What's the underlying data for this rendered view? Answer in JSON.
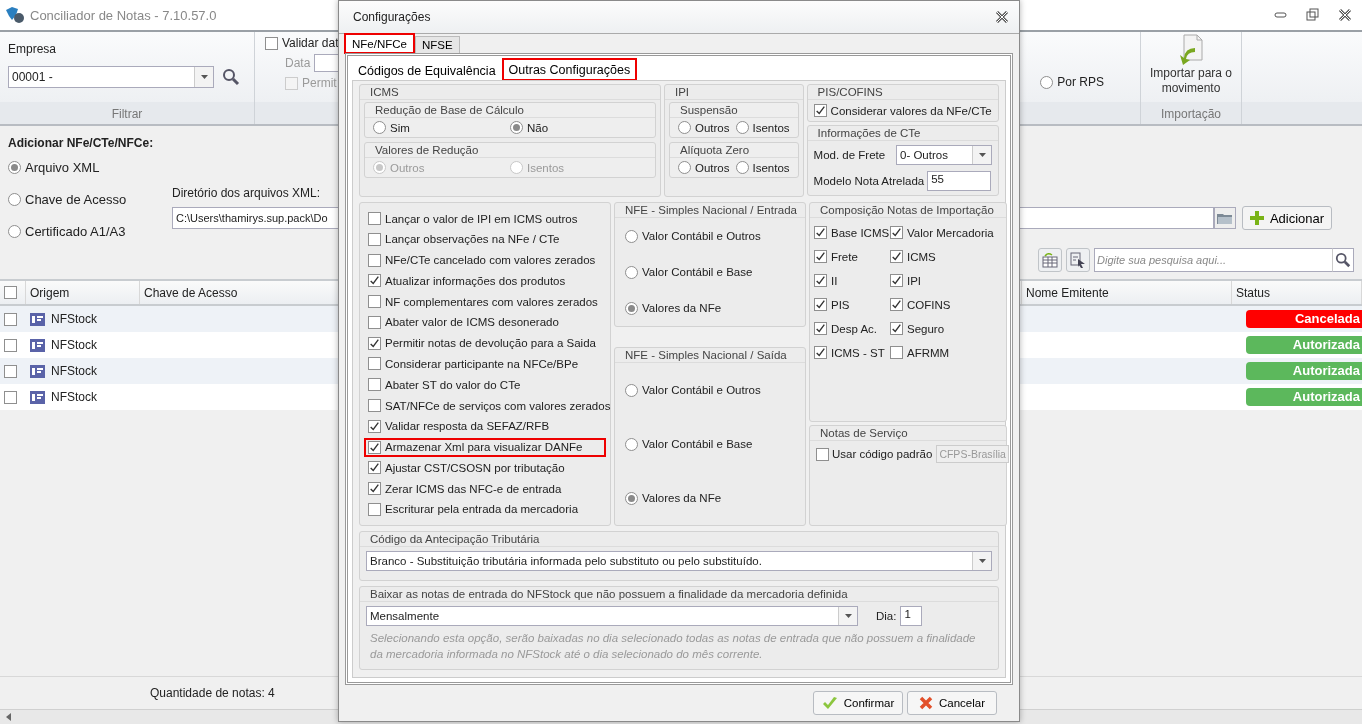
{
  "app": {
    "title": "Conciliador de Notas - 7.10.57.0",
    "ribbon": {
      "empresa_label": "Empresa",
      "empresa_value": "00001 -",
      "filter_group": "Filtrar",
      "validar": {
        "label": "Validar dat",
        "checked": false
      },
      "data_label": "Data",
      "permit": {
        "label": "Permit",
        "checked": false,
        "disabled": true
      },
      "por_rps": {
        "label": "Por RPS",
        "selected": false
      },
      "import_button": "Importar para o movimento",
      "import_group": "Importação"
    },
    "add_section": {
      "title": "Adicionar NFe/CTe/NFCe:",
      "sources": [
        {
          "label": "Arquivo XML",
          "selected": true
        },
        {
          "label": "Chave de Acesso",
          "selected": false
        },
        {
          "label": "Certificado A1/A3",
          "selected": false
        }
      ],
      "dir_label": "Diretório dos arquivos XML:",
      "dir_value": "C:\\Users\\thamirys.sup.pack\\Do",
      "add_button": "Adicionar",
      "search_placeholder": "Digite sua pesquisa aqui..."
    },
    "table": {
      "select_all_checked": false,
      "columns": [
        "Origem",
        "Chave de Acesso",
        "Nome Emitente",
        "Status"
      ],
      "rows": [
        {
          "checked": false,
          "origin": "NFStock",
          "status": "Cancelada",
          "color": "#ff0000"
        },
        {
          "checked": false,
          "origin": "NFStock",
          "status": "Autorizada",
          "color": "#5cb85c"
        },
        {
          "checked": false,
          "origin": "NFStock",
          "status": "Autorizada",
          "color": "#5cb85c"
        },
        {
          "checked": false,
          "origin": "NFStock",
          "status": "Autorizada",
          "color": "#5cb85c"
        }
      ]
    },
    "footer": "Quantidade de notas: 4"
  },
  "dialog": {
    "title": "Configurações",
    "tabs": [
      {
        "label": "NFe/NFCe",
        "selected": true,
        "highlighted": true
      },
      {
        "label": "NFSE",
        "selected": false,
        "highlighted": false
      }
    ],
    "subtabs": [
      {
        "label": "Códigos de Equivalência",
        "selected": false,
        "highlighted": false
      },
      {
        "label": "Outras Configurações",
        "selected": true,
        "highlighted": true
      }
    ],
    "icms": {
      "title": "ICMS",
      "groups": [
        {
          "title": "Redução de Base de Cálculo",
          "disabled": false,
          "options": [
            {
              "label": "Sim",
              "selected": false
            },
            {
              "label": "Não",
              "selected": true
            }
          ]
        },
        {
          "title": "Valores de Redução",
          "disabled": true,
          "options": [
            {
              "label": "Outros",
              "selected": true
            },
            {
              "label": "Isentos",
              "selected": false
            }
          ]
        }
      ]
    },
    "ipi": {
      "title": "IPI",
      "groups": [
        {
          "title": "Suspensão",
          "disabled": false,
          "options": [
            {
              "label": "Outros",
              "selected": false
            },
            {
              "label": "Isentos",
              "selected": false
            }
          ]
        },
        {
          "title": "Alíquota Zero",
          "disabled": false,
          "options": [
            {
              "label": "Outros",
              "selected": false
            },
            {
              "label": "Isentos",
              "selected": false
            }
          ]
        }
      ]
    },
    "pis_cofins": {
      "title": "PIS/COFINS",
      "label": "Considerar valores da NFe/CTe",
      "checked": true
    },
    "cte": {
      "title": "Informações de CTe",
      "frete_label": "Mod. de Frete",
      "frete_value": "0- Outros",
      "modelo_label": "Modelo Nota Atrelada",
      "modelo_value": "55"
    },
    "options": [
      {
        "label": "Lançar o valor de IPI em ICMS outros",
        "checked": false,
        "highlighted": false
      },
      {
        "label": "Lançar observações na NFe / CTe",
        "checked": false,
        "highlighted": false
      },
      {
        "label": "NFe/CTe cancelado com valores zerados",
        "checked": false,
        "highlighted": false
      },
      {
        "label": "Atualizar informações dos produtos",
        "checked": true,
        "highlighted": false
      },
      {
        "label": "NF complementares com valores zerados",
        "checked": false,
        "highlighted": false
      },
      {
        "label": "Abater valor de ICMS desonerado",
        "checked": false,
        "highlighted": false
      },
      {
        "label": "Permitir notas de devolução para a Saida",
        "checked": true,
        "highlighted": false
      },
      {
        "label": "Considerar participante na NFCe/BPe",
        "checked": false,
        "highlighted": false
      },
      {
        "label": "Abater ST do valor do CTe",
        "checked": false,
        "highlighted": false
      },
      {
        "label": "SAT/NFCe de serviços com valores zerados",
        "checked": false,
        "highlighted": false
      },
      {
        "label": "Validar resposta da SEFAZ/RFB",
        "checked": true,
        "highlighted": false
      },
      {
        "label": "Armazenar Xml para visualizar DANFe",
        "checked": true,
        "highlighted": true
      },
      {
        "label": "Ajustar CST/CSOSN por tributação",
        "checked": true,
        "highlighted": false
      },
      {
        "label": "Zerar ICMS das NFC-e de entrada",
        "checked": true,
        "highlighted": false
      },
      {
        "label": "Escriturar pela entrada da mercadoria",
        "checked": false,
        "highlighted": false
      }
    ],
    "simples": [
      {
        "title": "NFE - Simples Nacional / Entrada",
        "options": [
          {
            "label": "Valor Contábil e Outros",
            "selected": false
          },
          {
            "label": "Valor Contábil e Base",
            "selected": false
          },
          {
            "label": "Valores da NFe",
            "selected": true
          }
        ]
      },
      {
        "title": "NFE - Simples Nacional / Saída",
        "options": [
          {
            "label": "Valor Contábil e Outros",
            "selected": false
          },
          {
            "label": "Valor Contábil e Base",
            "selected": false
          },
          {
            "label": "Valores da NFe",
            "selected": true
          }
        ]
      }
    ],
    "composicao": {
      "title": "Composição Notas de Importação",
      "items": [
        {
          "label": "Base ICMS",
          "checked": true
        },
        {
          "label": "Valor Mercadoria",
          "checked": true
        },
        {
          "label": "Frete",
          "checked": true
        },
        {
          "label": "ICMS",
          "checked": true
        },
        {
          "label": "II",
          "checked": true
        },
        {
          "label": "IPI",
          "checked": true
        },
        {
          "label": "PIS",
          "checked": true
        },
        {
          "label": "COFINS",
          "checked": true
        },
        {
          "label": "Desp Ac.",
          "checked": true
        },
        {
          "label": "Seguro",
          "checked": true
        },
        {
          "label": "ICMS - ST",
          "checked": true
        },
        {
          "label": "AFRMM",
          "checked": false
        }
      ]
    },
    "servico": {
      "title": "Notas de Serviço",
      "label": "Usar código padrão",
      "checked": false,
      "button": "CFPS-Brasília"
    },
    "antecipacao": {
      "title": "Código da Antecipação Tributária",
      "value": "Branco - Substituição tributária informada pelo substituto ou pelo substituído."
    },
    "baixar": {
      "title": "Baixar as notas de entrada do NFStock que não possuem a finalidade da mercadoria definida",
      "value": "Mensalmente",
      "dia_label": "Dia:",
      "dia_value": "1",
      "note": "Selecionando esta opção, serão baixadas no dia selecionado todas as notas de entrada que não possuem a finalidade da mercadoria informada no NFStock até o dia selecionado do mês corrente."
    },
    "buttons": [
      {
        "label": "Confirmar",
        "kind": "confirm"
      },
      {
        "label": "Cancelar",
        "kind": "cancel"
      }
    ]
  }
}
